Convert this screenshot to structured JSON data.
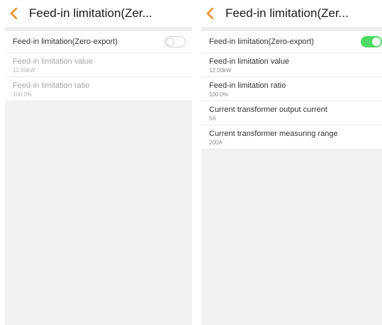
{
  "colors": {
    "accent": "#f08a24",
    "toggle_on": "#4cd964",
    "background": "#f2f2f2"
  },
  "left_screen": {
    "header": {
      "back_icon": "chevron-left-icon",
      "title": "Feed-in limitation(Zer..."
    },
    "toggle": {
      "label": "Feed-in limitation(Zero-export)",
      "state": "off"
    },
    "settings": [
      {
        "label": "Feed-in limitation value",
        "value": "12.00kW"
      },
      {
        "label": "Feed-in limitation ratio",
        "value": "100.0%"
      }
    ]
  },
  "right_screen": {
    "header": {
      "back_icon": "chevron-left-icon",
      "title": "Feed-in limitation(Zer..."
    },
    "toggle": {
      "label": "Feed-in limitation(Zero-export)",
      "state": "on"
    },
    "settings": [
      {
        "label": "Feed-in limitation value",
        "value": "12.00kW"
      },
      {
        "label": "Feed-in limitation ratio",
        "value": "100.0%"
      },
      {
        "label": "Current transformer output current",
        "value": "5A"
      },
      {
        "label": "Current transformer measuring range",
        "value": "200A"
      }
    ]
  }
}
